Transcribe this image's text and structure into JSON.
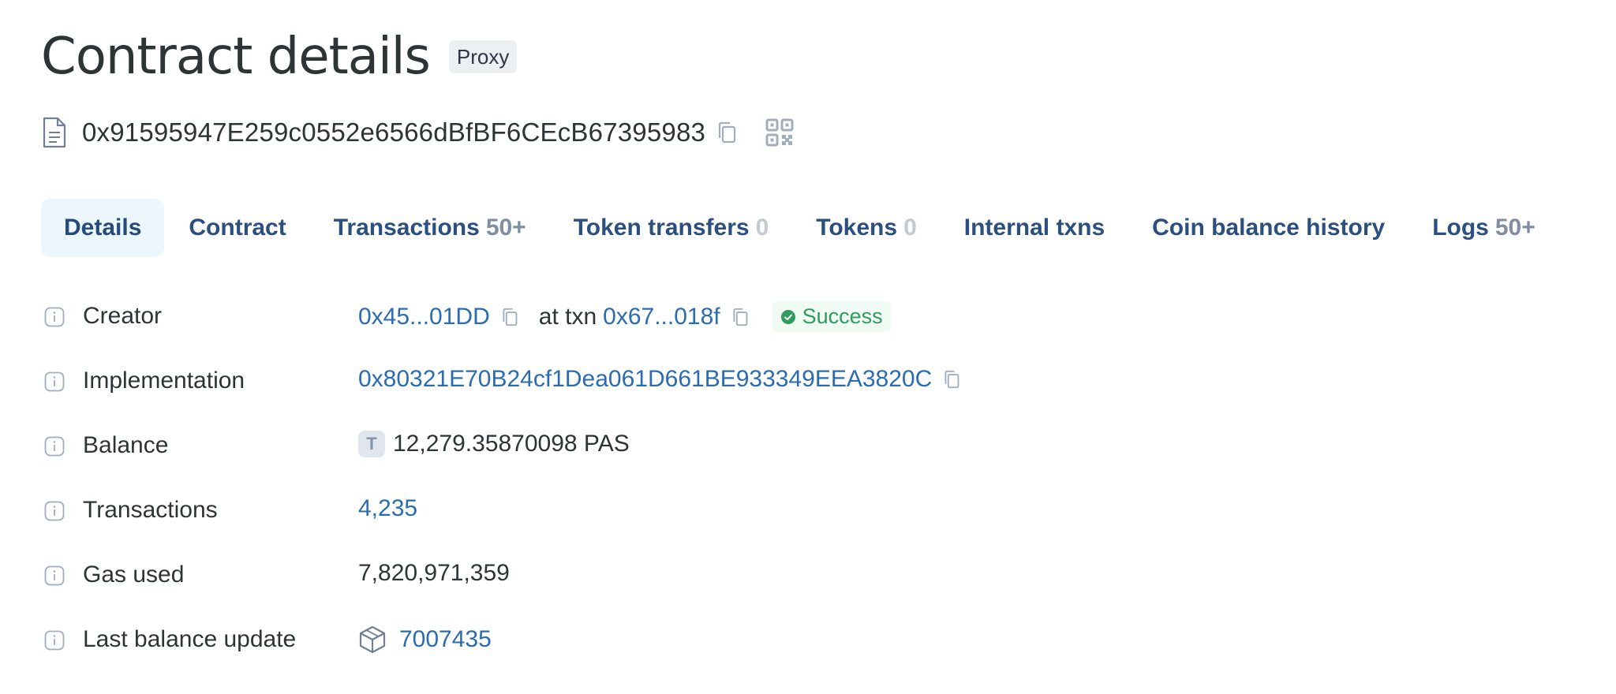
{
  "header": {
    "title": "Contract details",
    "tag": "Proxy"
  },
  "address": {
    "value": "0x91595947E259c0552e6566dBfBF6CEcB67395983",
    "icons": [
      "document-icon",
      "copy-icon",
      "qr-code-icon"
    ]
  },
  "tabs": [
    {
      "label": "Details",
      "count": "",
      "active": true
    },
    {
      "label": "Contract",
      "count": ""
    },
    {
      "label": "Transactions",
      "count": "50+"
    },
    {
      "label": "Token transfers",
      "count": "0"
    },
    {
      "label": "Tokens",
      "count": "0"
    },
    {
      "label": "Internal txns",
      "count": ""
    },
    {
      "label": "Coin balance history",
      "count": ""
    },
    {
      "label": "Logs",
      "count": "50+"
    }
  ],
  "details": {
    "creator": {
      "label": "Creator",
      "address": "0x45...01DD",
      "at_txn": "at txn",
      "txn": "0x67...018f",
      "status": "Success"
    },
    "implementation": {
      "label": "Implementation",
      "address": "0x80321E70B24cf1Dea061D661BE933349EEA3820C"
    },
    "balance": {
      "label": "Balance",
      "token_letter": "T",
      "value": "12,279.35870098 PAS"
    },
    "transactions": {
      "label": "Transactions",
      "value": "4,235"
    },
    "gas_used": {
      "label": "Gas used",
      "value": "7,820,971,359"
    },
    "last_balance_update": {
      "label": "Last balance update",
      "block": "7007435"
    }
  },
  "colors": {
    "link": "#2b6cb0",
    "tab_text": "#2b4f7e",
    "tab_active_bg": "#ebf6fd",
    "success": "#2f9b5c",
    "success_bg": "#f0fbf4",
    "icon_gray": "#a0aec0"
  }
}
